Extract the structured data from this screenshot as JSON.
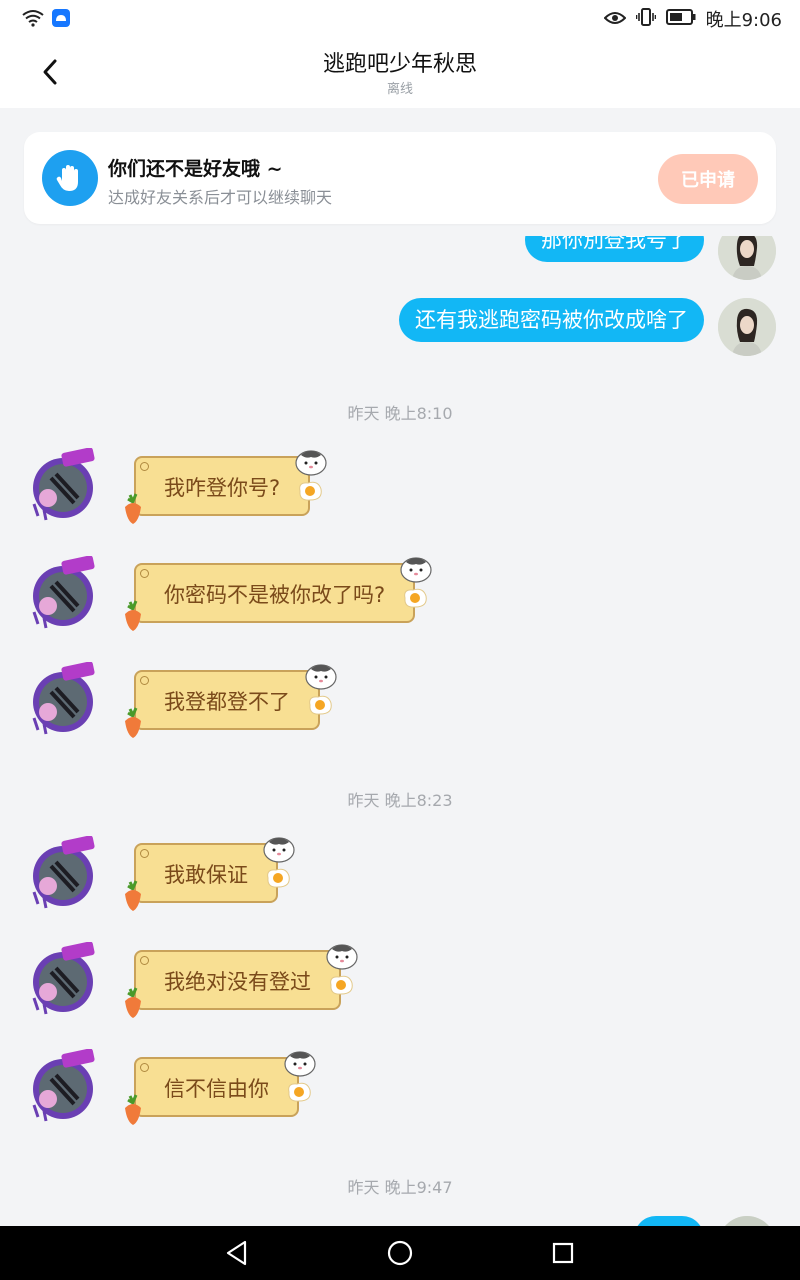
{
  "status": {
    "time": "晚上9:06"
  },
  "nav": {
    "title": "逃跑吧少年秋思",
    "subtitle": "离线"
  },
  "friend_card": {
    "title": "你们还不是好友哦 ~",
    "subtitle": "达成好友关系后才可以继续聊天",
    "button": "已申请"
  },
  "messages": {
    "mine": [
      {
        "text": "那你別登我号了"
      },
      {
        "text": "还有我逃跑密码被你改成啥了"
      }
    ],
    "timestamps": [
      "昨天 晚上8:10",
      "昨天 晚上8:23",
      "昨天 晚上9:47"
    ],
    "theirs": [
      {
        "text": "我咋登你号?"
      },
      {
        "text": "你密码不是被你改了吗?"
      },
      {
        "text": "我登都登不了"
      },
      {
        "text": "我敢保证"
      },
      {
        "text": "我绝对没有登过"
      },
      {
        "text": "信不信由你"
      }
    ]
  },
  "colors": {
    "my_bubble": "#12b7f5",
    "their_bubble": "#f8df93",
    "applied_button": "#ffc9b8"
  }
}
